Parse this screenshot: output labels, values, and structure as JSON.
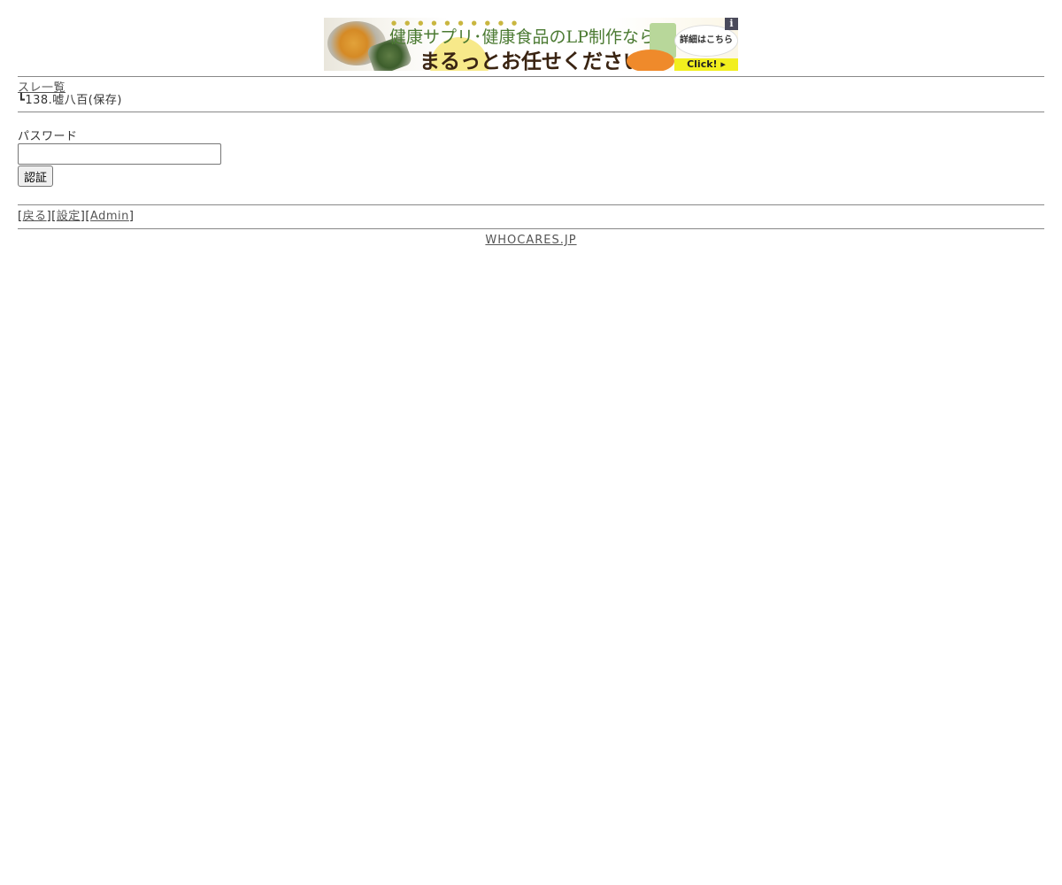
{
  "banner": {
    "line1": "健康サプリ･健康食品のLP制作なら",
    "line2": "まるっとお任せください!",
    "bubble": "詳細はこちら",
    "click": "Click! ▸",
    "info_icon": "i",
    "colors": {
      "green": "#4b7a32",
      "brown": "#3a2412",
      "yellow": "#f2ef1e"
    }
  },
  "nav": {
    "thread_list_link": "スレ一覧",
    "breadcrumb": "┗138.嘘八百(保存)"
  },
  "form": {
    "password_label": "パスワード",
    "password_value": "",
    "auth_button": "認証"
  },
  "links": {
    "open1": "[",
    "back": "戻る",
    "sep1": "][",
    "settings": "設定",
    "sep2": "][",
    "admin": "Admin",
    "close": "]"
  },
  "footer": {
    "site": "WHOCARES.JP"
  }
}
